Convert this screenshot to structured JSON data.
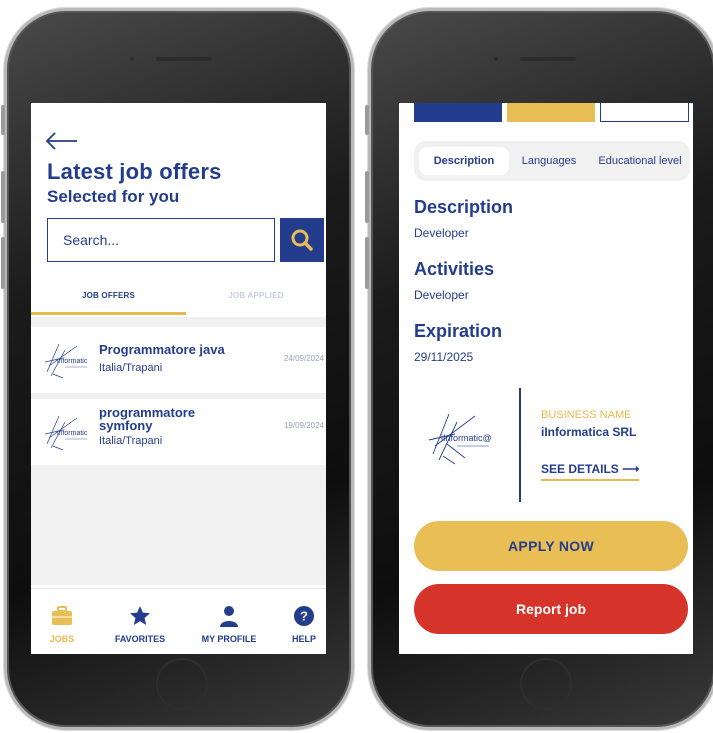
{
  "left_screen": {
    "title": "Latest job offers",
    "subtitle": "Selected for you",
    "search": {
      "placeholder": "Search..."
    },
    "tabs": [
      {
        "label": "JOB OFFERS",
        "active": true
      },
      {
        "label": "JOB APPLIED",
        "active": false
      }
    ],
    "jobs": [
      {
        "title": "Programmatore java",
        "location": "Italia/Trapani",
        "date": "24/09/2024",
        "logo_icon": "informatic-logo"
      },
      {
        "title": "programmatore symfony",
        "location": "Italia/Trapani",
        "date": "19/09/2024",
        "logo_icon": "informatic-logo"
      }
    ],
    "nav": [
      {
        "label": "JOBS",
        "icon": "briefcase-icon",
        "active": true
      },
      {
        "label": "FAVORITES",
        "icon": "star-icon",
        "active": false
      },
      {
        "label": "MY PROFILE",
        "icon": "user-icon",
        "active": false
      },
      {
        "label": "HELP",
        "icon": "help-icon",
        "active": false
      }
    ],
    "logo_text": "informatic"
  },
  "right_screen": {
    "tabs": [
      {
        "label": "Description",
        "active": true
      },
      {
        "label": "Languages",
        "active": false
      },
      {
        "label": "Educational level",
        "active": false
      }
    ],
    "sections": [
      {
        "title": "Description",
        "text": "Developer"
      },
      {
        "title": "Activities",
        "text": "Developer"
      },
      {
        "title": "Expiration",
        "text": "29/11/2025"
      }
    ],
    "business": {
      "label": "BUSINESS NAME",
      "name": "iInformatica SRL",
      "details_label": "SEE DETAILS",
      "details_arrow": "⟶",
      "logo_text": "iInformatic@"
    },
    "apply_label": "APPLY NOW",
    "report_label": "Report job"
  },
  "colors": {
    "brand_blue": "#233d8c",
    "accent_yellow": "#e8be55",
    "danger_red": "#d6342a",
    "list_bg": "#f1f1f1"
  }
}
